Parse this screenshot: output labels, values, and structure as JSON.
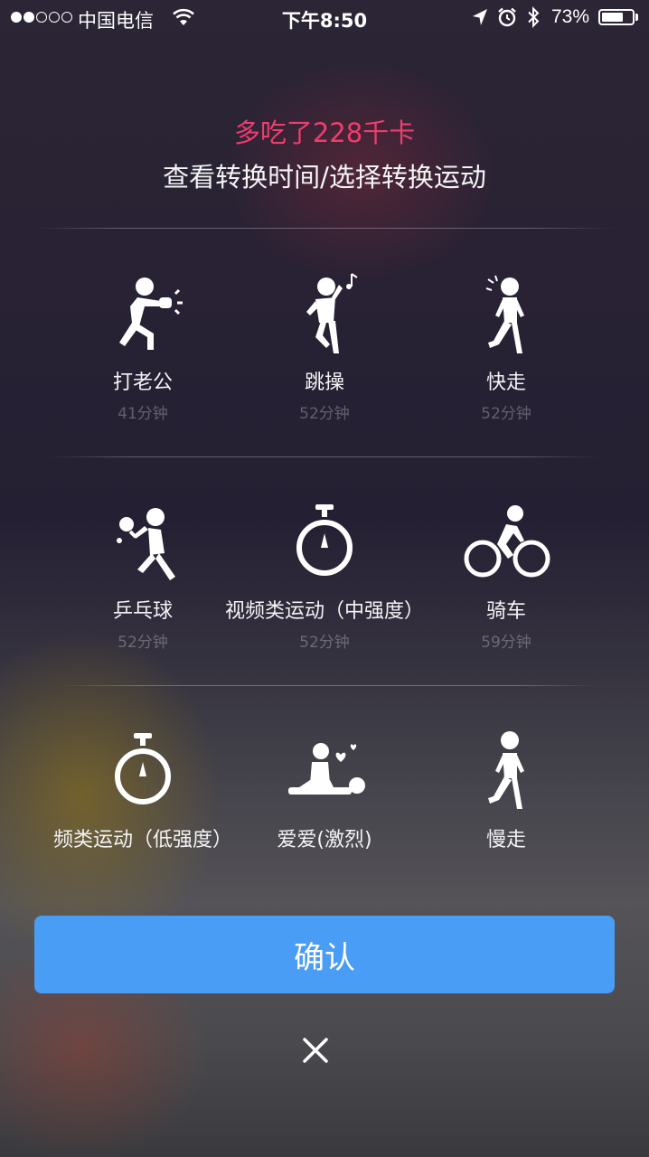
{
  "status_bar": {
    "carrier": "中国电信",
    "time": "下午8:50",
    "battery_percent": "73%",
    "battery_level": 0.73,
    "signal_bars": 2,
    "icons": [
      "wifi-icon",
      "location-arrow-icon",
      "alarm-clock-icon",
      "bluetooth-icon",
      "battery-icon"
    ]
  },
  "header": {
    "headline": "多吃了228千卡",
    "subline": "查看转换时间/选择转换运动",
    "headline_color": "#ee3d6e"
  },
  "activities": [
    {
      "name": "打老公",
      "duration": "41分钟",
      "icon": "punching-person-icon"
    },
    {
      "name": "跳操",
      "duration": "52分钟",
      "icon": "dancing-person-icon"
    },
    {
      "name": "快走",
      "duration": "52分钟",
      "icon": "fast-walking-person-icon"
    },
    {
      "name": "乒乓球",
      "duration": "52分钟",
      "icon": "ping-pong-player-icon"
    },
    {
      "name": "视频类运动（中强度）",
      "duration": "52分钟",
      "icon": "stopwatch-icon"
    },
    {
      "name": "骑车",
      "duration": "59分钟",
      "icon": "cyclist-icon"
    },
    {
      "name": "频类运动（低强度）",
      "duration": "",
      "icon": "stopwatch-icon"
    },
    {
      "name": "爱爱(激烈)",
      "duration": "",
      "icon": "couple-icon"
    },
    {
      "name": "慢走",
      "duration": "",
      "icon": "walking-person-icon"
    }
  ],
  "confirm_button": {
    "label": "确认",
    "color": "#4a9df5"
  },
  "close_button": {
    "icon": "close-icon"
  }
}
